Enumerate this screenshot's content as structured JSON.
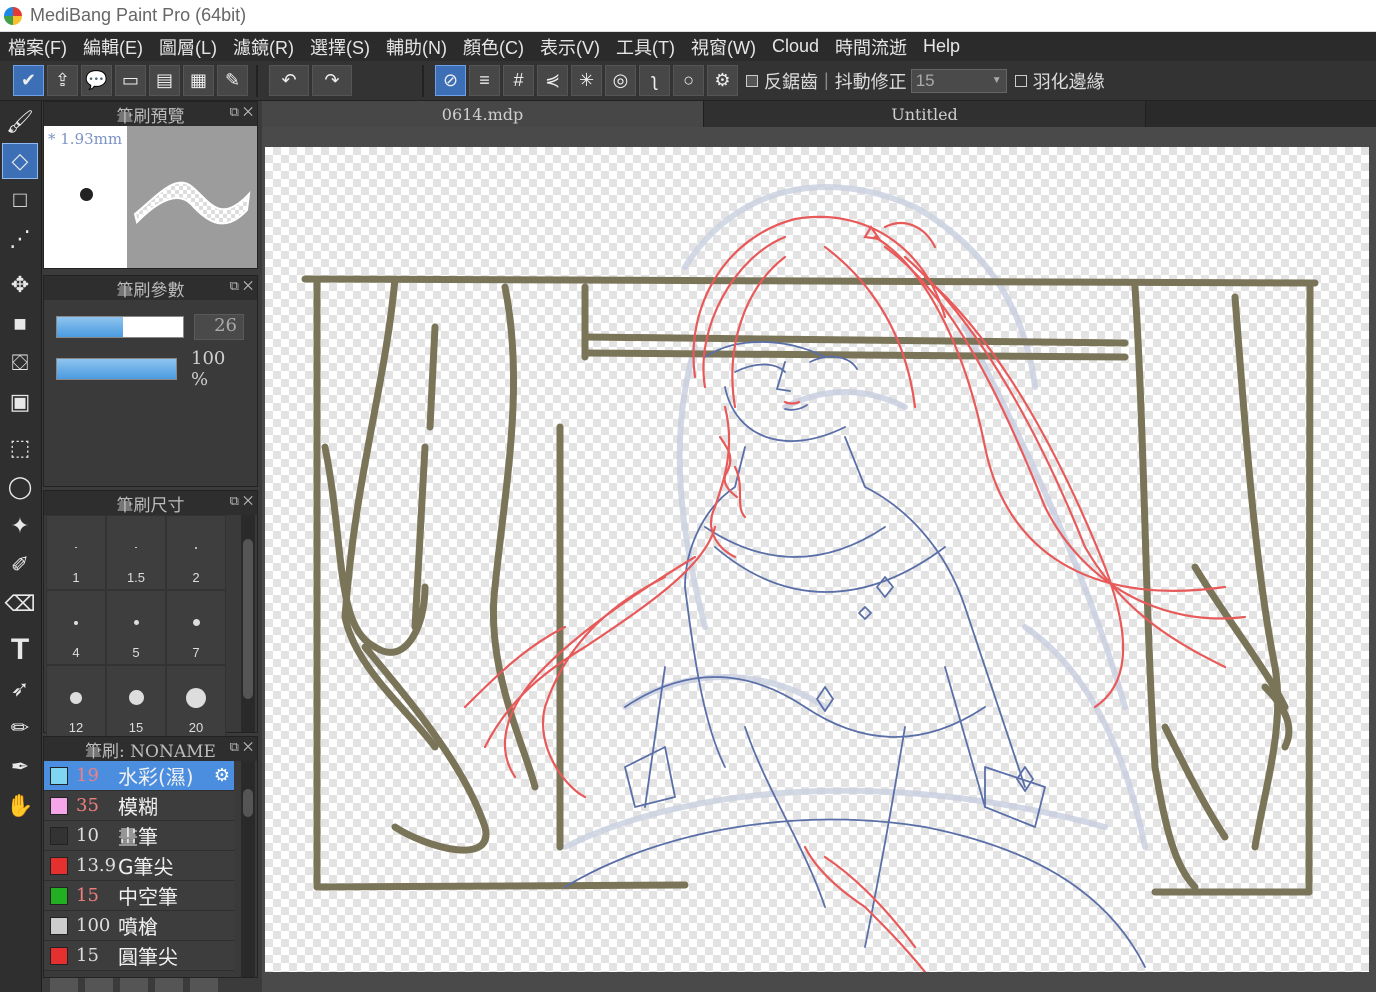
{
  "window": {
    "title": "MediBang Paint Pro (64bit)"
  },
  "menu": [
    "檔案(F)",
    "編輯(E)",
    "圖層(L)",
    "濾鏡(R)",
    "選擇(S)",
    "輔助(N)",
    "顏色(C)",
    "表示(V)",
    "工具(T)",
    "視窗(W)",
    "Cloud",
    "時間流逝",
    "Help"
  ],
  "toolbar": {
    "antialias_label": "反鋸齒",
    "stabilizer_label": "抖動修正",
    "stabilizer_value": "15",
    "feather_label": "羽化邊緣"
  },
  "panels": {
    "preview": {
      "title": "筆刷預覽",
      "size_label": "* 1.93mm"
    },
    "params": {
      "title": "筆刷參數",
      "size_value": "26",
      "size_fraction": 0.52,
      "opacity_value": "100 %",
      "opacity_fraction": 1.0
    },
    "sizes": {
      "title": "筆刷尺寸",
      "items": [
        {
          "label": "1",
          "dot": 1
        },
        {
          "label": "1.5",
          "dot": 1.5
        },
        {
          "label": "2",
          "dot": 2
        },
        {
          "label": "4",
          "dot": 4
        },
        {
          "label": "5",
          "dot": 5
        },
        {
          "label": "7",
          "dot": 7
        },
        {
          "label": "12",
          "dot": 12
        },
        {
          "label": "15",
          "dot": 15
        },
        {
          "label": "20",
          "dot": 20
        }
      ]
    },
    "brushes": {
      "title": "筆刷: NONAME",
      "items": [
        {
          "size": "19",
          "name": "水彩(濕)",
          "color": "#7fd6f3",
          "size_color": "#f08080",
          "active": true
        },
        {
          "size": "35",
          "name": "模糊",
          "color": "#f4a6e8",
          "size_color": "#f08080",
          "active": false
        },
        {
          "size": "10",
          "name": "畫筆",
          "color": "#333333",
          "size_color": "#dddddd",
          "active": false
        },
        {
          "size": "13.9",
          "name": "G筆尖",
          "color": "#e53030",
          "size_color": "#dddddd",
          "active": false
        },
        {
          "size": "15",
          "name": "中空筆",
          "color": "#22b022",
          "size_color": "#f08080",
          "active": false
        },
        {
          "size": "100",
          "name": "噴槍",
          "color": "#cccccc",
          "size_color": "#dddddd",
          "active": false
        },
        {
          "size": "15",
          "name": "圓筆尖",
          "color": "#e53030",
          "size_color": "#dddddd",
          "active": false
        }
      ]
    }
  },
  "tabs": [
    "0614.mdp",
    "Untitled"
  ],
  "colors": {
    "accent": "#3d6fb6",
    "sketch_red": "#e85a5a",
    "sketch_blue": "#5a6fa8",
    "frame_olive": "#7a7458"
  }
}
